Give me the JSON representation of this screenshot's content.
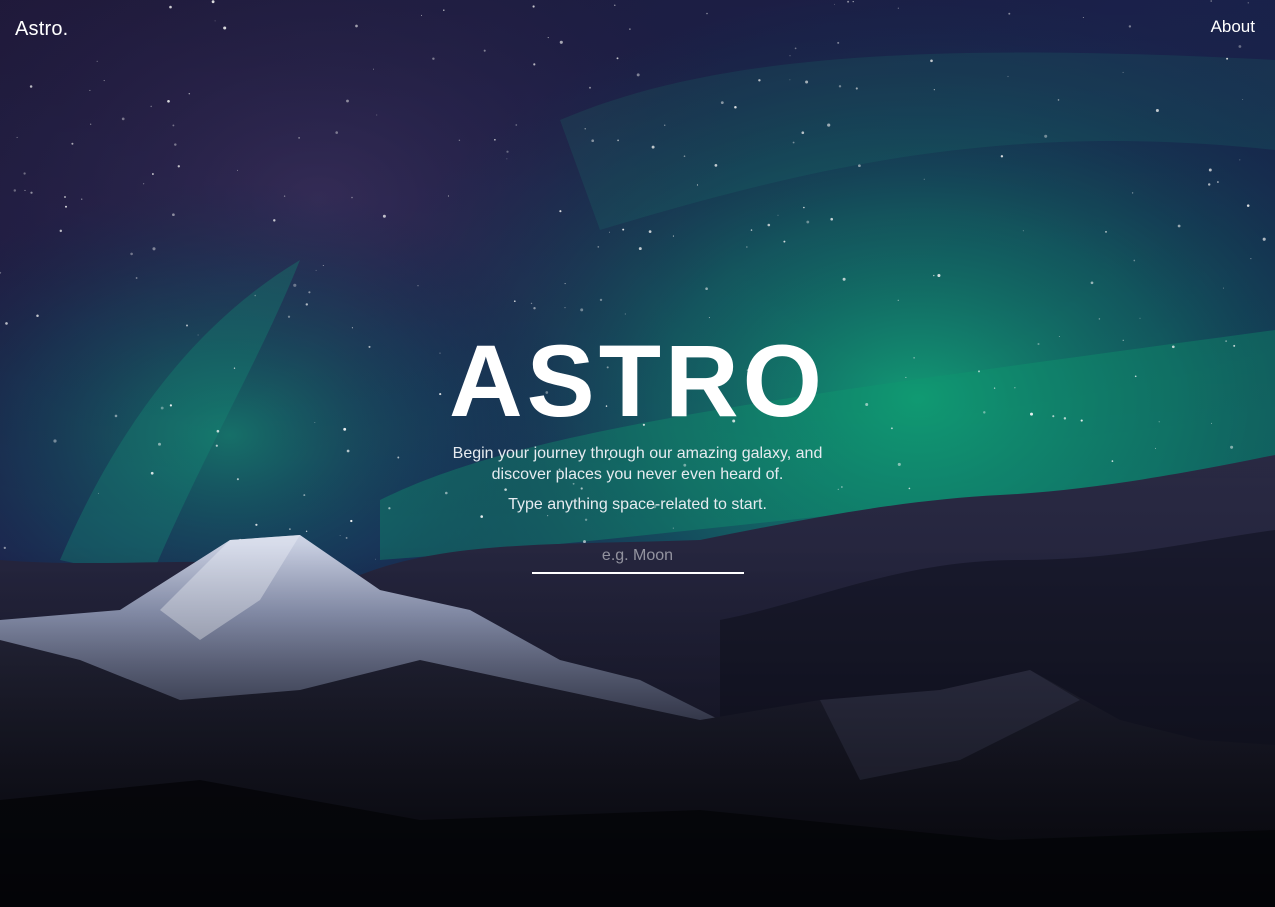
{
  "header": {
    "brand": "Astro.",
    "nav": {
      "about_label": "About"
    }
  },
  "hero": {
    "title": "ASTRO",
    "subtitle": "Begin your journey through our amazing galaxy, and discover places you never even heard of.",
    "hint": "Type anything space-related to start."
  },
  "search": {
    "placeholder": "e.g. Moon",
    "value": ""
  },
  "colors": {
    "sky_top": "#1c1a3c",
    "aurora": "#0f9a6e",
    "mountain_snow": "#c3c9dc",
    "text": "#ffffff"
  }
}
